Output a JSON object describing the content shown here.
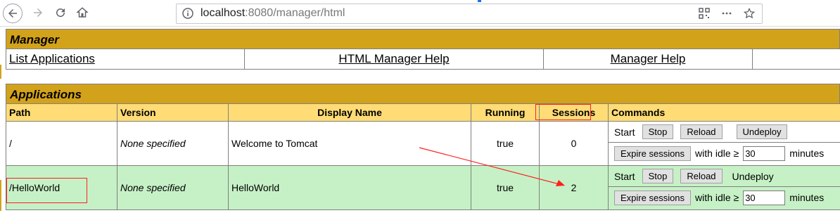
{
  "browser": {
    "url_host": "localhost",
    "url_rest": ":8080/manager/html"
  },
  "manager": {
    "title": "Manager",
    "links": [
      "List Applications",
      "HTML Manager Help",
      "Manager Help"
    ]
  },
  "applications": {
    "title": "Applications",
    "headers": {
      "path": "Path",
      "version": "Version",
      "display_name": "Display Name",
      "running": "Running",
      "sessions": "Sessions",
      "commands": "Commands"
    },
    "rows": [
      {
        "path": "/",
        "version": "None specified",
        "display_name": "Welcome to Tomcat",
        "running": "true",
        "sessions": "0",
        "start": "Start",
        "stop": "Stop",
        "reload": "Reload",
        "undeploy": "Undeploy",
        "expire": "Expire sessions",
        "with_idle": "with idle ≥",
        "idle_value": "30",
        "minutes": "minutes"
      },
      {
        "path": "/HelloWorld",
        "version": "None specified",
        "display_name": "HelloWorld",
        "running": "true",
        "sessions": "2",
        "start": "Start",
        "stop": "Stop",
        "reload": "Reload",
        "undeploy": "Undeploy",
        "expire": "Expire sessions",
        "with_idle": "with idle ≥",
        "idle_value": "30",
        "minutes": "minutes"
      }
    ]
  },
  "colors": {
    "section_header": "#d3a21b",
    "column_header": "#ffdc75",
    "row_highlight": "#c6f1c6",
    "annotation": "#ff2020"
  }
}
